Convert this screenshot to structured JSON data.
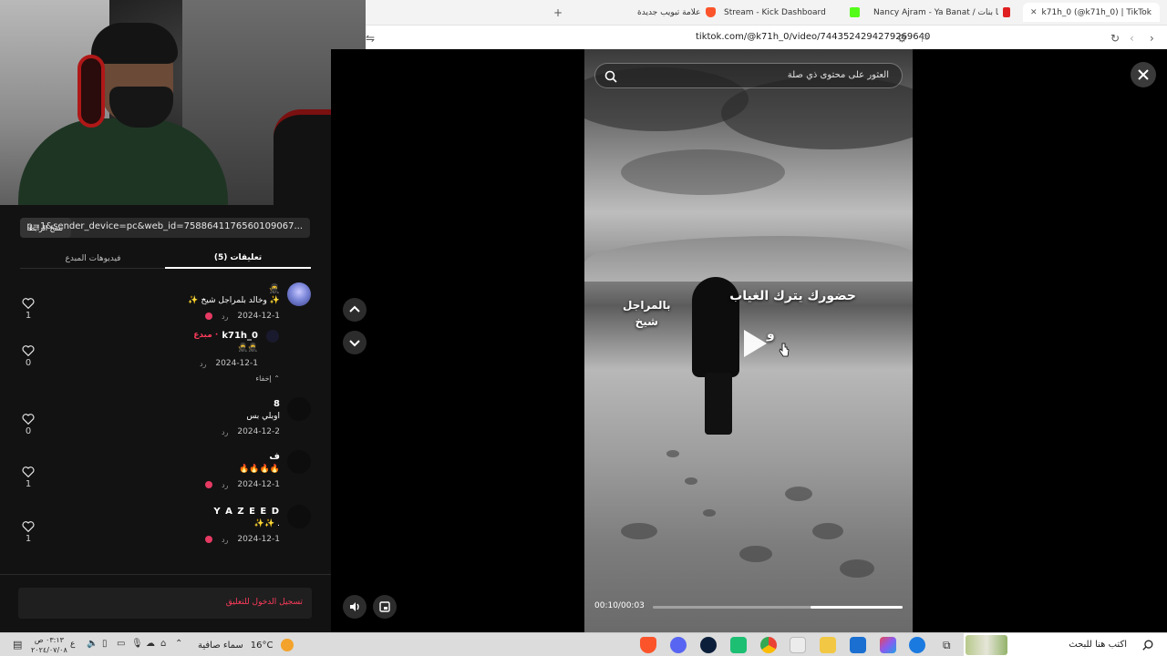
{
  "browser": {
    "tabs": [
      {
        "label": "k71h_0 (@k71h_0) | TikTok",
        "active": true
      },
      {
        "label": "Nancy Ajram - Ya Banat / نانسي عجرم - يا بنات",
        "active": false
      },
      {
        "label": "Stream - Kick Dashboard",
        "active": false
      },
      {
        "label": "علامة تبويب جديدة",
        "active": false
      }
    ],
    "new_tab": "+",
    "url": "tiktok.com/@k71h_0/video/7443524294279269640"
  },
  "share": {
    "link_text": "p=1&sender_device=pc&web_id=7588641176560109067...",
    "copy_label": "نسخ الرابط"
  },
  "panel_tabs": {
    "comments": "تعليقات (5)",
    "creator_videos": "فيديوهات المبدع"
  },
  "comments": [
    {
      "name": "🥷",
      "text": "✨ وخالد بلمراجل شيخ ✨",
      "date": "2024-12-1",
      "reply": "رد",
      "likes": "1"
    },
    {
      "name": "k71h_0",
      "creator": "مبدع ·",
      "text": "🥷🥷",
      "date": "2024-12-1",
      "reply": "رد",
      "likes": "0",
      "hide": "إخفاء"
    },
    {
      "name": "8",
      "text": "اوبلي بس",
      "date": "2024-12-2",
      "reply": "رد",
      "likes": "0"
    },
    {
      "name": "ف",
      "text": "🔥🔥🔥🔥",
      "date": "2024-12-1",
      "reply": "رد",
      "likes": "1"
    },
    {
      "name": "Y A Z E E D",
      "text": "✨✨ .",
      "date": "2024-12-1",
      "reply": "رد",
      "likes": "1"
    }
  ],
  "login_prompt": "تسجيل الدخول للتعليق",
  "video": {
    "search_placeholder": "العثور على محتوى ذي صلة",
    "overlay_line1": "حضورك يترك الغياب",
    "overlay_line2a": "بالمراجل",
    "overlay_line2b": "شيخ",
    "overlay_line3": "و",
    "time": "00:10/00:03",
    "progress_fraction": 0.37
  },
  "taskbar": {
    "search_text": "اكتب هنا للبحث",
    "weather_temp": "16°C",
    "weather_desc": "سماء صافية",
    "lang": "ع",
    "time": "٠٣:١٣ ص",
    "date": "٢٠٢٤/٠٧/٠٨"
  },
  "colors": {
    "accent": "#ff3b5c",
    "panel_bg": "#121212",
    "stage_bg": "#000000"
  }
}
